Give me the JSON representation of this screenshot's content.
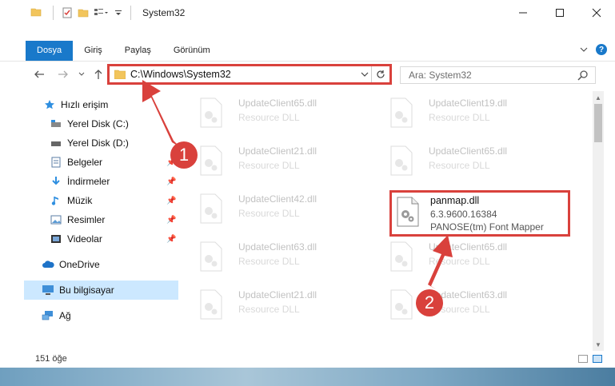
{
  "window": {
    "title": "System32"
  },
  "ribbon": {
    "tabs": [
      "Dosya",
      "Giriş",
      "Paylaş",
      "Görünüm"
    ],
    "help": "?"
  },
  "address": {
    "path": "C:\\Windows\\System32"
  },
  "search": {
    "placeholder": "Ara: System32"
  },
  "sidebar": {
    "items": [
      {
        "label": "Hızlı erişim",
        "icon": "star-icon"
      },
      {
        "label": "Yerel Disk (C:)",
        "icon": "drive-icon"
      },
      {
        "label": "Yerel Disk (D:)",
        "icon": "drive-icon"
      },
      {
        "label": "Belgeler",
        "icon": "documents-icon"
      },
      {
        "label": "İndirmeler",
        "icon": "download-icon"
      },
      {
        "label": "Müzik",
        "icon": "music-icon"
      },
      {
        "label": "Resimler",
        "icon": "pictures-icon"
      },
      {
        "label": "Videolar",
        "icon": "video-icon"
      },
      {
        "label": "OneDrive",
        "icon": "cloud-icon"
      },
      {
        "label": "Bu bilgisayar",
        "icon": "computer-icon"
      },
      {
        "label": "Ağ",
        "icon": "network-icon"
      }
    ]
  },
  "files": {
    "left": [
      {
        "name": "UpdateClient65.dll",
        "desc": "Resource DLL"
      },
      {
        "name": "UpdateClient21.dll",
        "desc": "Resource DLL"
      },
      {
        "name": "UpdateClient42.dll",
        "desc": "Resource DLL"
      },
      {
        "name": "UpdateClient63.dll",
        "desc": "Resource DLL"
      },
      {
        "name": "UpdateClient21.dll",
        "desc": "Resource DLL"
      }
    ],
    "right": [
      {
        "name": "UpdateClient19.dll",
        "desc": "Resource DLL"
      },
      {
        "name": "UpdateClient65.dll",
        "desc": "Resource DLL"
      },
      {
        "name": "UpdateClient65.dll",
        "desc": "Resource DLL"
      },
      {
        "name": "UpdateClient63.dll",
        "desc": "Resource DLL"
      }
    ],
    "highlighted": {
      "name": "panmap.dll",
      "version": "6.3.9600.16384",
      "description": "PANOSE(tm) Font Mapper"
    }
  },
  "status": {
    "count": "151 öğe"
  },
  "annotations": {
    "step1": "1",
    "step2": "2",
    "color": "#d9413c"
  }
}
